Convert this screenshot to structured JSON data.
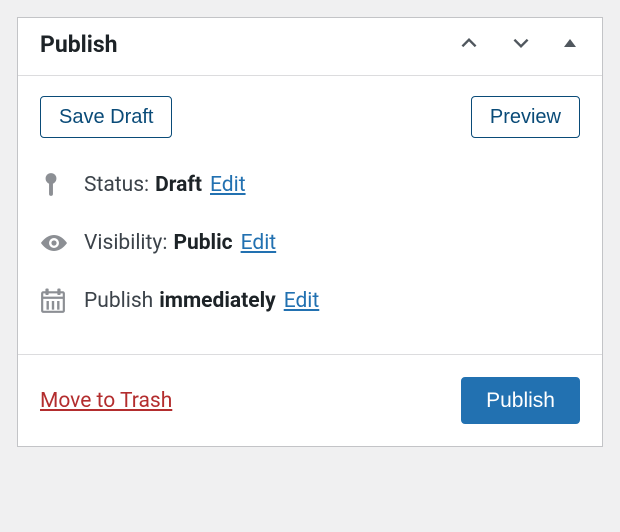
{
  "panel": {
    "title": "Publish"
  },
  "actions": {
    "save_draft": "Save Draft",
    "preview": "Preview"
  },
  "status": {
    "label": "Status:",
    "value": "Draft",
    "edit": "Edit"
  },
  "visibility": {
    "label": "Visibility:",
    "value": "Public",
    "edit": "Edit"
  },
  "schedule": {
    "label": "Publish",
    "value": "immediately",
    "edit": "Edit"
  },
  "footer": {
    "trash": "Move to Trash",
    "publish": "Publish"
  }
}
